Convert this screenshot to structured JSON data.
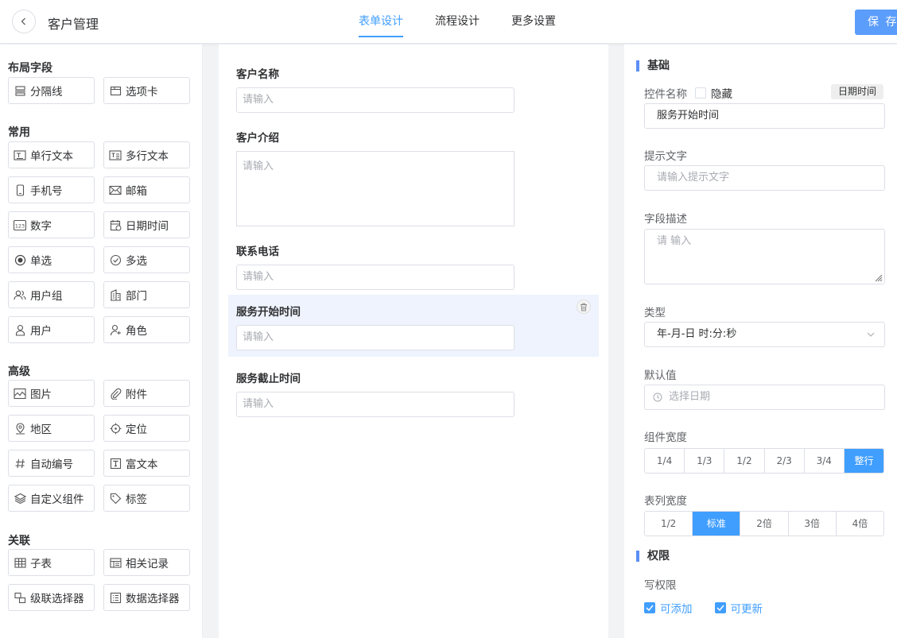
{
  "header": {
    "title": "客户管理",
    "tabs": [
      "表单设计",
      "流程设计",
      "更多设置"
    ],
    "active_tab": 0,
    "save_label": "保 存"
  },
  "palette": {
    "groups": [
      {
        "title": "布局字段",
        "items": [
          {
            "label": "分隔线",
            "icon": "divider-icon"
          },
          {
            "label": "选项卡",
            "icon": "tabs-icon"
          }
        ]
      },
      {
        "title": "常用",
        "items": [
          {
            "label": "单行文本",
            "icon": "single-line-text-icon"
          },
          {
            "label": "多行文本",
            "icon": "multi-line-text-icon"
          },
          {
            "label": "手机号",
            "icon": "mobile-icon"
          },
          {
            "label": "邮箱",
            "icon": "mail-icon"
          },
          {
            "label": "数字",
            "icon": "number-icon"
          },
          {
            "label": "日期时间",
            "icon": "calendar-icon"
          },
          {
            "label": "单选",
            "icon": "radio-icon"
          },
          {
            "label": "多选",
            "icon": "checkbox-icon"
          },
          {
            "label": "用户组",
            "icon": "user-group-icon"
          },
          {
            "label": "部门",
            "icon": "department-icon"
          },
          {
            "label": "用户",
            "icon": "user-icon"
          },
          {
            "label": "角色",
            "icon": "role-icon"
          }
        ]
      },
      {
        "title": "高级",
        "items": [
          {
            "label": "图片",
            "icon": "image-icon"
          },
          {
            "label": "附件",
            "icon": "attachment-icon"
          },
          {
            "label": "地区",
            "icon": "location-pin-icon"
          },
          {
            "label": "定位",
            "icon": "locate-icon"
          },
          {
            "label": "自动编号",
            "icon": "hash-icon"
          },
          {
            "label": "富文本",
            "icon": "rich-text-icon"
          },
          {
            "label": "自定义组件",
            "icon": "layers-icon"
          },
          {
            "label": "标签",
            "icon": "tag-icon"
          }
        ]
      },
      {
        "title": "关联",
        "items": [
          {
            "label": "子表",
            "icon": "table-icon"
          },
          {
            "label": "相关记录",
            "icon": "related-records-icon"
          },
          {
            "label": "级联选择器",
            "icon": "cascader-icon"
          },
          {
            "label": "数据选择器",
            "icon": "data-selector-icon"
          }
        ]
      }
    ]
  },
  "form": {
    "fields": [
      {
        "label": "客户名称",
        "placeholder": "请输入",
        "type": "input"
      },
      {
        "label": "客户介绍",
        "placeholder": "请输入",
        "type": "textarea"
      },
      {
        "label": "联系电话",
        "placeholder": "请输入",
        "type": "input"
      },
      {
        "label": "服务开始时间",
        "placeholder": "请输入",
        "type": "input",
        "selected": true
      },
      {
        "label": "服务截止时间",
        "placeholder": "请输入",
        "type": "input"
      }
    ]
  },
  "props": {
    "basic_title": "基础",
    "control_name_label": "控件名称",
    "hide_label": "隐藏",
    "type_tag": "日期时间",
    "control_name_value": "服务开始时间",
    "hint_label": "提示文字",
    "hint_placeholder": "请输入提示文字",
    "desc_label": "字段描述",
    "desc_placeholder": "请 输入",
    "type_label": "类型",
    "type_value": "年-月-日 时:分:秒",
    "default_label": "默认值",
    "default_placeholder": "选择日期",
    "width_label": "组件宽度",
    "width_options": [
      "1/4",
      "1/3",
      "1/2",
      "2/3",
      "3/4",
      "整行"
    ],
    "width_selected": 5,
    "col_width_label": "表列宽度",
    "col_width_options": [
      "1/2",
      "标准",
      "2倍",
      "3倍",
      "4倍"
    ],
    "col_width_selected": 1,
    "perm_title": "权限",
    "write_perm_label": "写权限",
    "can_add_label": "可添加",
    "can_update_label": "可更新"
  },
  "colors": {
    "accent": "#409eff",
    "save": "#5b9dfb",
    "selected_bg": "#eef3fd"
  }
}
